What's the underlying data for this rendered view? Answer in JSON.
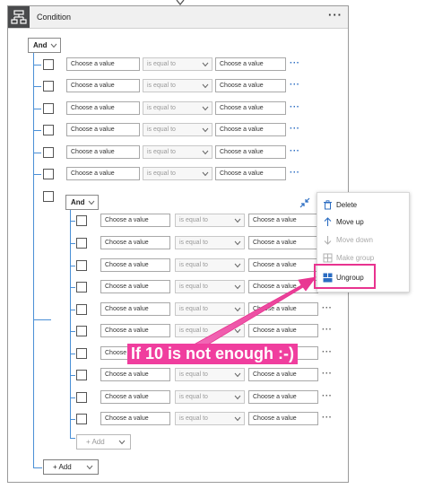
{
  "header": {
    "title": "Condition",
    "menu": "···"
  },
  "outer_group": {
    "operator": "And",
    "rows": [
      {
        "value1": "Choose a value",
        "operator": "is equal to",
        "value2": "Choose a value",
        "more": "···"
      },
      {
        "value1": "Choose a value",
        "operator": "is equal to",
        "value2": "Choose a value",
        "more": "···"
      },
      {
        "value1": "Choose a value",
        "operator": "is equal to",
        "value2": "Choose a value",
        "more": "···"
      },
      {
        "value1": "Choose a value",
        "operator": "is equal to",
        "value2": "Choose a value",
        "more": "···"
      },
      {
        "value1": "Choose a value",
        "operator": "is equal to",
        "value2": "Choose a value",
        "more": "···"
      },
      {
        "value1": "Choose a value",
        "operator": "is equal to",
        "value2": "Choose a value",
        "more": "···"
      }
    ],
    "add_label": "+ Add"
  },
  "inner_group": {
    "operator": "And",
    "rows": [
      {
        "value1": "Choose a value",
        "operator": "is equal to",
        "value2": "Choose a value",
        "more": "···"
      },
      {
        "value1": "Choose a value",
        "operator": "is equal to",
        "value2": "Choose a value",
        "more": "···"
      },
      {
        "value1": "Choose a value",
        "operator": "is equal to",
        "value2": "Choose a value",
        "more": "···"
      },
      {
        "value1": "Choose a value",
        "operator": "is equal to",
        "value2": "Choose a value",
        "more": "···"
      },
      {
        "value1": "Choose a value",
        "operator": "is equal to",
        "value2": "Choose a value",
        "more": "···"
      },
      {
        "value1": "Choose a value",
        "operator": "is equal to",
        "value2": "Choose a value",
        "more": "···"
      },
      {
        "value1": "Choose a value",
        "operator": "is equal to",
        "value2": "Choose a value",
        "more": "···"
      },
      {
        "value1": "Choose a value",
        "operator": "is equal to",
        "value2": "Choose a value",
        "more": "···"
      },
      {
        "value1": "Choose a value",
        "operator": "is equal to",
        "value2": "Choose a value",
        "more": "···"
      },
      {
        "value1": "Choose a value",
        "operator": "is equal to",
        "value2": "Choose a value",
        "more": "···"
      }
    ],
    "add_label": "+ Add"
  },
  "context_menu": {
    "items": [
      {
        "label": "Delete",
        "icon": "trash-icon",
        "enabled": true
      },
      {
        "label": "Move up",
        "icon": "arrow-up-icon",
        "enabled": true
      },
      {
        "label": "Move down",
        "icon": "arrow-down-icon",
        "enabled": false
      },
      {
        "label": "Make group",
        "icon": "make-group-icon",
        "enabled": false
      },
      {
        "label": "Ungroup",
        "icon": "ungroup-icon",
        "enabled": true
      }
    ]
  },
  "annotation": {
    "text": "If 10 is not enough :-)"
  },
  "colors": {
    "header_bg": "#f0f0f0",
    "header_icon_bg": "#494a4c",
    "tree_line": "#4a8fd6",
    "accent_blue": "#2b6cc2",
    "highlight_pink": "#e8338f",
    "annotation_bg": "#f03e9e"
  }
}
